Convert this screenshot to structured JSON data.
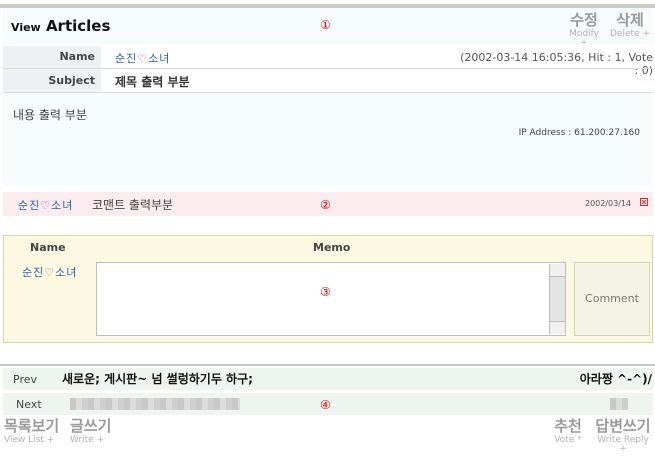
{
  "header": {
    "title_small": "View",
    "title_main": "Articles",
    "marker": "①",
    "modify": {
      "korean": "수정",
      "english": "Modify +"
    },
    "delete": {
      "korean": "삭제",
      "english": "Delete +"
    }
  },
  "info": {
    "name_label": "Name",
    "subject_label": "Subject",
    "nick_a": "순진",
    "nick_heart": "♡",
    "nick_b": "소녀",
    "meta": "(2002-03-14 16:05:36, Hit : 1, Vote : 0)",
    "subject": "제목 출력 부분"
  },
  "content": {
    "body": "내용 출력 부분",
    "ip": "IP Address : 61.200.27.160"
  },
  "comment": {
    "text": "코맨트 출력부분",
    "marker": "②",
    "date": "2002/03/14",
    "delete_icon": "x-box-icon"
  },
  "form": {
    "name_header": "Name",
    "memo_header": "Memo",
    "marker": "③",
    "submit": "Comment"
  },
  "nav": {
    "prev_label": "Prev",
    "prev_title": "새로운; 게시판~ 넘 썰렁하기두 하구;",
    "prev_author": "아라짱 ^-^)/",
    "next_label": "Next",
    "marker": "④"
  },
  "footer": {
    "list": {
      "korean": "목록보기",
      "english": "View List +"
    },
    "write": {
      "korean": "글쓰기",
      "english": "Write +"
    },
    "vote": {
      "korean": "추천",
      "english": "Vote *"
    },
    "reply": {
      "korean": "답변쓰기",
      "english": "Write Reply +"
    }
  }
}
